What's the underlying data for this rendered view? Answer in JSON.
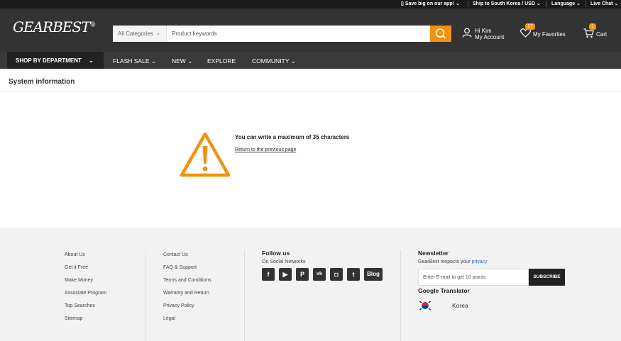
{
  "topbar": {
    "app": "Save big on our app!",
    "ship": "Ship to South Korea / USD",
    "language": "Language",
    "chat": "Live Chat"
  },
  "header": {
    "logo": "GEARBEST",
    "search": {
      "category": "All Categories",
      "placeholder": "Product keywords"
    },
    "account": {
      "greeting": "Hi Kim",
      "label": "My Account"
    },
    "favorites": {
      "count": "17",
      "label": "My Favorites"
    },
    "cart": {
      "count": "1",
      "label": "Cart"
    }
  },
  "nav": {
    "department": "SHOP BY DEPARTMENT",
    "items": [
      "FLASH SALE",
      "NEW",
      "EXPLORE",
      "COMMUNITY"
    ]
  },
  "main": {
    "title": "System information",
    "message": "You can write a maximum of 35 characters",
    "back_link": "Return to the previous page"
  },
  "footer": {
    "col1": [
      "About Us",
      "Get it Free",
      "Make Money",
      "Associate Program",
      "Top Searches",
      "Sitemap"
    ],
    "col2": [
      "Contact Us",
      "FAQ & Support",
      "Terms and Conditions",
      "Warranty and Return",
      "Privacy Policy",
      "Legal"
    ],
    "follow": {
      "title": "Follow us",
      "subtitle": "On Social Networks",
      "blog": "Blog"
    },
    "newsletter": {
      "title": "Newsletter",
      "subtitle": "GearBest respects your",
      "privacy": "privacy",
      "placeholder": "Enter E-mail to get 10 points",
      "button": "SUBSCRIBE"
    },
    "translator": {
      "title": "Google Translator",
      "language": "Korea"
    }
  },
  "colors": {
    "accent": "#f39110",
    "header_bg": "#333333",
    "footer_bg": "#f2f2f2"
  }
}
